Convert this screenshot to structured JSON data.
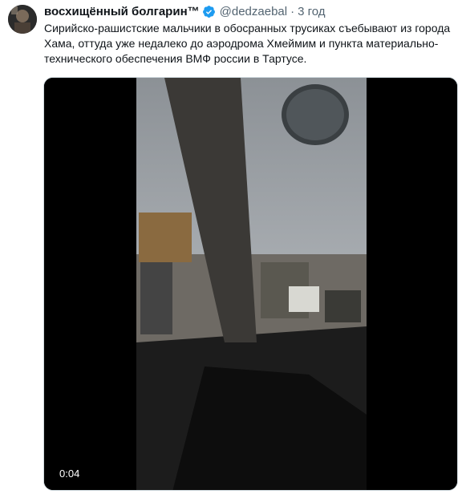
{
  "tweet": {
    "display_name": "восхищённый болгарин™",
    "handle": "@dedzaebal",
    "separator": "·",
    "time": "3 год",
    "text": "Сирийско-рашистские мальчики в обосранных трусиках съебывают из города Хама, оттуда уже недалеко до аэродрома Хмеймим и пункта материально-технического обеспечения ВМФ россии в Тартусе."
  },
  "media": {
    "timestamp": "0:04"
  },
  "colors": {
    "text_primary": "#0f1419",
    "text_secondary": "#536471",
    "verified_badge": "#1d9bf0",
    "video_background": "#000000"
  },
  "icons": {
    "verified": "verified-badge-icon"
  }
}
